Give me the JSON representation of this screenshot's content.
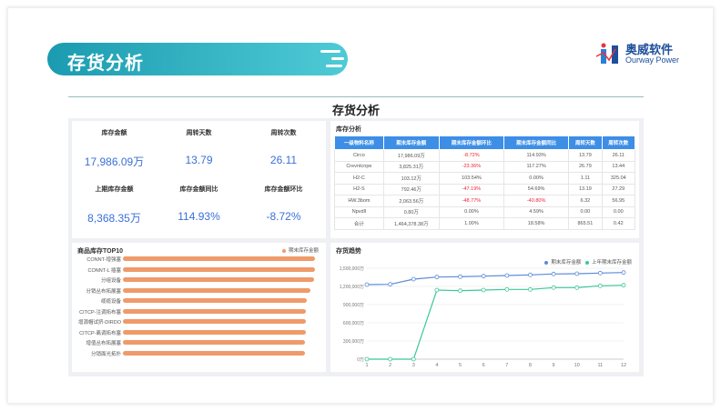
{
  "banner_title": "存货分析",
  "logo": {
    "name": "奥威软件",
    "sub": "Ourway Power"
  },
  "dashboard_title": "存货分析",
  "kpis": [
    {
      "label": "库存金额",
      "value": "17,986.09万"
    },
    {
      "label": "周转天数",
      "value": "13.79"
    },
    {
      "label": "周转次数",
      "value": "26.11"
    },
    {
      "label": "上期库存金额",
      "value": "8,368.35万"
    },
    {
      "label": "库存金额同比",
      "value": "114.93%"
    },
    {
      "label": "库存金额环比",
      "value": "-8.72%"
    }
  ],
  "table": {
    "title": "库存分析",
    "headers": [
      "一级物料名称",
      "期末库存金额",
      "期末库存金额环比",
      "期末库存金额同比",
      "周转天数",
      "周转次数"
    ],
    "rows": [
      [
        "Circo",
        "17,986.09万",
        "-8.72%",
        "114.93%",
        "13.79",
        "26.11"
      ],
      [
        "Crevntcnpe",
        "3,825.31万",
        "-23.36%",
        "117.27%",
        "26.79",
        "13.44"
      ],
      [
        "H2-C",
        "103.12万",
        "103.54%",
        "0.00%",
        "1.11",
        "325.04"
      ],
      [
        "H2-S",
        "792.46万",
        "-47.19%",
        "54.69%",
        "13.19",
        "27.29"
      ],
      [
        "HW.3bom",
        "2,063.56万",
        "-48.77%",
        "-40.80%",
        "6.32",
        "56.95"
      ],
      [
        "Npvdll",
        "0.80万",
        "0.00%",
        "4.59%",
        "0.00",
        "0.00"
      ],
      [
        "合计",
        "1,464,378.38万",
        "1.00%",
        "18.58%",
        "865.51",
        "0.42"
      ]
    ]
  },
  "chart_data": [
    {
      "type": "bar",
      "title": "商品库存TOP10",
      "legend": [
        "期末库存金额"
      ],
      "legend_position": "top-right",
      "orientation": "horizontal",
      "categories": [
        "CONNT-增强塞",
        "CONNT-L 插塞",
        "分组设备",
        "分销丛布拓展塞",
        "缆缆设备",
        "CITCP-注调拓布塞",
        "增源帽试挤-DIRDO",
        "CITCP-离调拓布塞",
        "增值丛布拓展塞",
        "分销面光拓扑"
      ],
      "values": [
        100,
        100,
        99.5,
        97.5,
        95.5,
        95.3,
        95.2,
        95.1,
        95,
        94.8
      ],
      "color": "#ef9a69"
    },
    {
      "type": "line",
      "title": "存货趋势",
      "legend_position": "top-right",
      "x": [
        1,
        2,
        3,
        4,
        5,
        6,
        7,
        8,
        9,
        10,
        11,
        12
      ],
      "y_ticks": [
        "0万",
        "300,000万",
        "600,000万",
        "900,000万",
        "1,200,000万",
        "1,500,000万"
      ],
      "ylim": [
        0,
        1500000
      ],
      "series": [
        {
          "name": "期末库存金额",
          "color": "#5b8bd6",
          "values": [
            1230000,
            1235000,
            1320000,
            1355000,
            1360000,
            1370000,
            1380000,
            1390000,
            1405000,
            1410000,
            1420000,
            1430000
          ]
        },
        {
          "name": "上年期末库存金额",
          "color": "#3cc79a",
          "values": [
            0,
            0,
            0,
            1140000,
            1130000,
            1140000,
            1150000,
            1150000,
            1180000,
            1180000,
            1210000,
            1220000
          ]
        }
      ]
    }
  ]
}
